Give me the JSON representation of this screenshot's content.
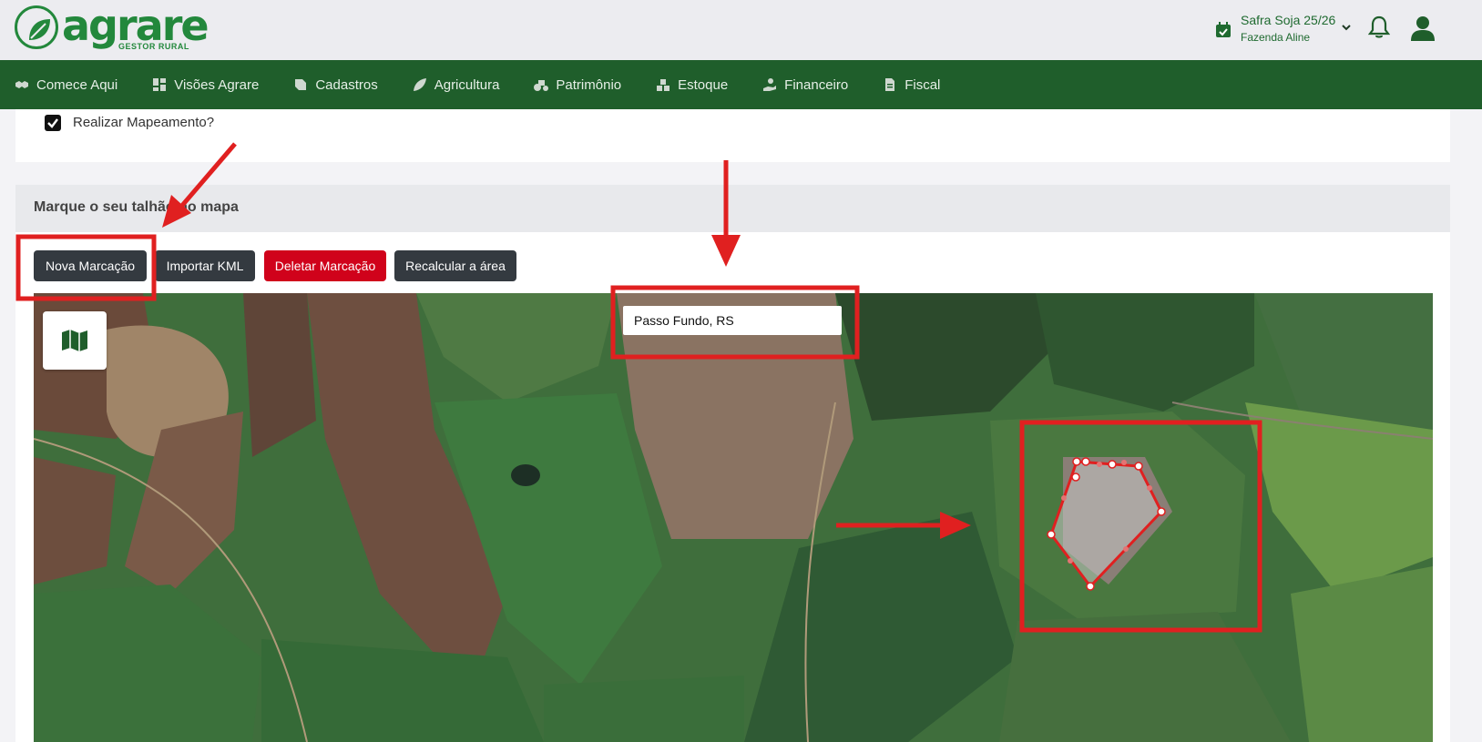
{
  "brand": {
    "name": "agrare",
    "tagline": "GESTOR RURAL"
  },
  "header": {
    "safra_title": "Safra Soja 25/26",
    "farm_name": "Fazenda Aline"
  },
  "nav": {
    "items": [
      {
        "label": "Comece Aqui",
        "icon": "handshake-icon"
      },
      {
        "label": "Visões Agrare",
        "icon": "dashboard-icon"
      },
      {
        "label": "Cadastros",
        "icon": "register-icon"
      },
      {
        "label": "Agricultura",
        "icon": "leaf-icon"
      },
      {
        "label": "Patrimônio",
        "icon": "tractor-icon"
      },
      {
        "label": "Estoque",
        "icon": "boxes-icon"
      },
      {
        "label": "Financeiro",
        "icon": "money-hand-icon"
      },
      {
        "label": "Fiscal",
        "icon": "invoice-icon"
      }
    ]
  },
  "mapping": {
    "checkbox_label": "Realizar Mapeamento?",
    "checked": true
  },
  "map_section": {
    "title": "Marque o seu talhão no mapa",
    "buttons": {
      "new": "Nova Marcação",
      "import": "Importar KML",
      "delete": "Deletar Marcação",
      "recalc": "Recalcular a área"
    },
    "search_value": "Passo Fundo, RS"
  },
  "colors": {
    "brand_green": "#23883c",
    "nav_green": "#1f5e2b",
    "danger_red": "#d0021b",
    "annotation_red": "#e02020"
  }
}
